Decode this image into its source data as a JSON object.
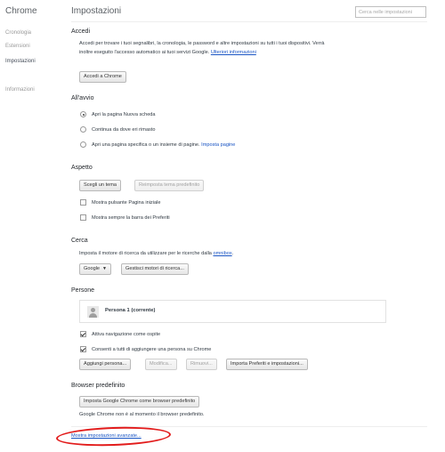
{
  "sidebar": {
    "brand": "Chrome",
    "items": [
      {
        "label": "Cronologia"
      },
      {
        "label": "Estensioni"
      },
      {
        "label": "Impostazioni"
      },
      {
        "label": "Informazioni"
      }
    ]
  },
  "header": {
    "title": "Impostazioni",
    "search_placeholder": "Cerca nelle impostazioni"
  },
  "signin": {
    "title": "Accedi",
    "line1": "Accedi per trovare i tuoi segnalibri, la cronologia, le password e altre impostazioni su tutti i tuoi dispositivi. Verrà",
    "line2": "inoltre eseguito l'accesso automatico ai tuoi servizi Google.",
    "learn_more": "Ulteriori informazioni",
    "button": "Accedi a Chrome"
  },
  "startup": {
    "title": "All'avvio",
    "options": [
      {
        "label": "Apri la pagina Nuova scheda",
        "selected": true
      },
      {
        "label": "Continua da dove eri rimasto",
        "selected": false
      },
      {
        "label": "Apri una pagina specifica o un insieme di pagine.",
        "selected": false
      }
    ],
    "set_pages_link": "Imposta pagine"
  },
  "appearance": {
    "title": "Aspetto",
    "theme_button": "Scegli un tema",
    "reset_theme_button": "Reimposta tema predefinito",
    "home_button_label": "Mostra pulsante Pagina iniziale",
    "bookmarks_bar_label": "Mostra sempre la barra dei Preferiti"
  },
  "search": {
    "title": "Cerca",
    "description": "Imposta il motore di ricerca da utilizzare per le ricerche dalla",
    "omnibox_link": "omnibox",
    "engine_selected": "Google",
    "manage_button": "Gestisci motori di ricerca..."
  },
  "people": {
    "title": "Persone",
    "profile_name": "Persona 1 (corrente)",
    "guest_label": "Attiva navigazione come ospite",
    "guest_checked": true,
    "add_person_label": "Consenti a tutti di aggiungere una persona su Chrome",
    "add_person_checked": true,
    "add_button": "Aggiungi persona...",
    "edit_button": "Modifica...",
    "remove_button": "Rimuovi...",
    "import_button": "Importa Preferiti e impostazioni..."
  },
  "default_browser": {
    "title": "Browser predefinito",
    "button": "Imposta Google Chrome come browser predefinito",
    "status": "Google Chrome non è al momento il browser predefinito."
  },
  "advanced": {
    "link": "Mostra impostazioni avanzate..."
  },
  "colors": {
    "link": "#1a55c4",
    "annotation": "#e21b1b"
  }
}
